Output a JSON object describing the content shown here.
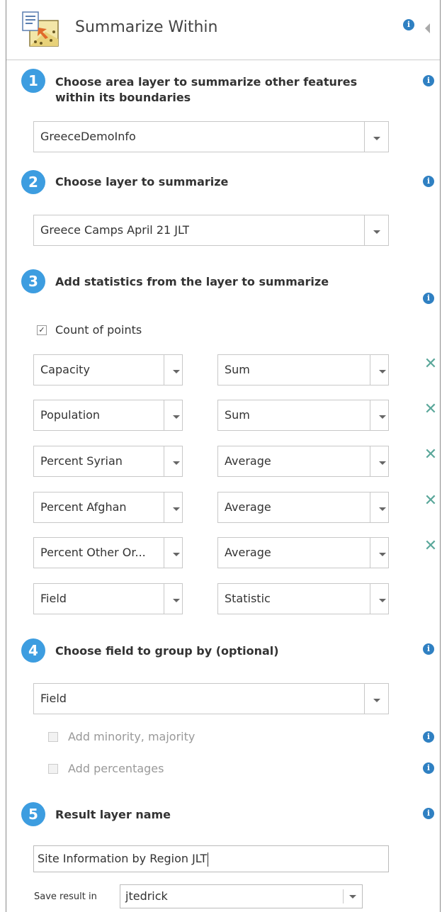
{
  "panel": {
    "title": "Summarize Within",
    "tool_icon": "summarize-within-tool-icon",
    "info_icon": "info-icon",
    "collapse_icon": "collapse-left-icon"
  },
  "steps": [
    {
      "number": "1",
      "label_line1": "Choose area layer to summarize other features",
      "label_line2": "within its boundaries",
      "select_value": "GreeceDemoInfo"
    },
    {
      "number": "2",
      "label": "Choose layer to summarize",
      "select_value": "Greece Camps April 21 JLT"
    },
    {
      "number": "3",
      "label": "Add statistics from the layer to summarize",
      "count_of_points_label": "Count of points",
      "count_of_points_checked": true,
      "statistics": [
        {
          "field": "Capacity",
          "statistic": "Sum",
          "removable": true
        },
        {
          "field": "Population",
          "statistic": "Sum",
          "removable": true
        },
        {
          "field": "Percent Syrian",
          "statistic": "Average",
          "removable": true
        },
        {
          "field": "Percent Afghan",
          "statistic": "Average",
          "removable": true
        },
        {
          "field": "Percent Other Or...",
          "statistic": "Average",
          "removable": true
        },
        {
          "field": "Field",
          "statistic": "Statistic",
          "removable": false
        }
      ]
    },
    {
      "number": "4",
      "label": "Choose field to group by (optional)",
      "select_value": "Field",
      "minority_majority_label": "Add minority, majority",
      "percentages_label": "Add percentages"
    },
    {
      "number": "5",
      "label": "Result layer name",
      "result_name": "Site Information by Region JLT",
      "save_in_label": "Save result in",
      "save_in_value": "jtedrick"
    }
  ],
  "colors": {
    "step_badge": "#3d9de0",
    "info_icon": "#2f80c2",
    "remove_icon": "#5aa79a"
  }
}
